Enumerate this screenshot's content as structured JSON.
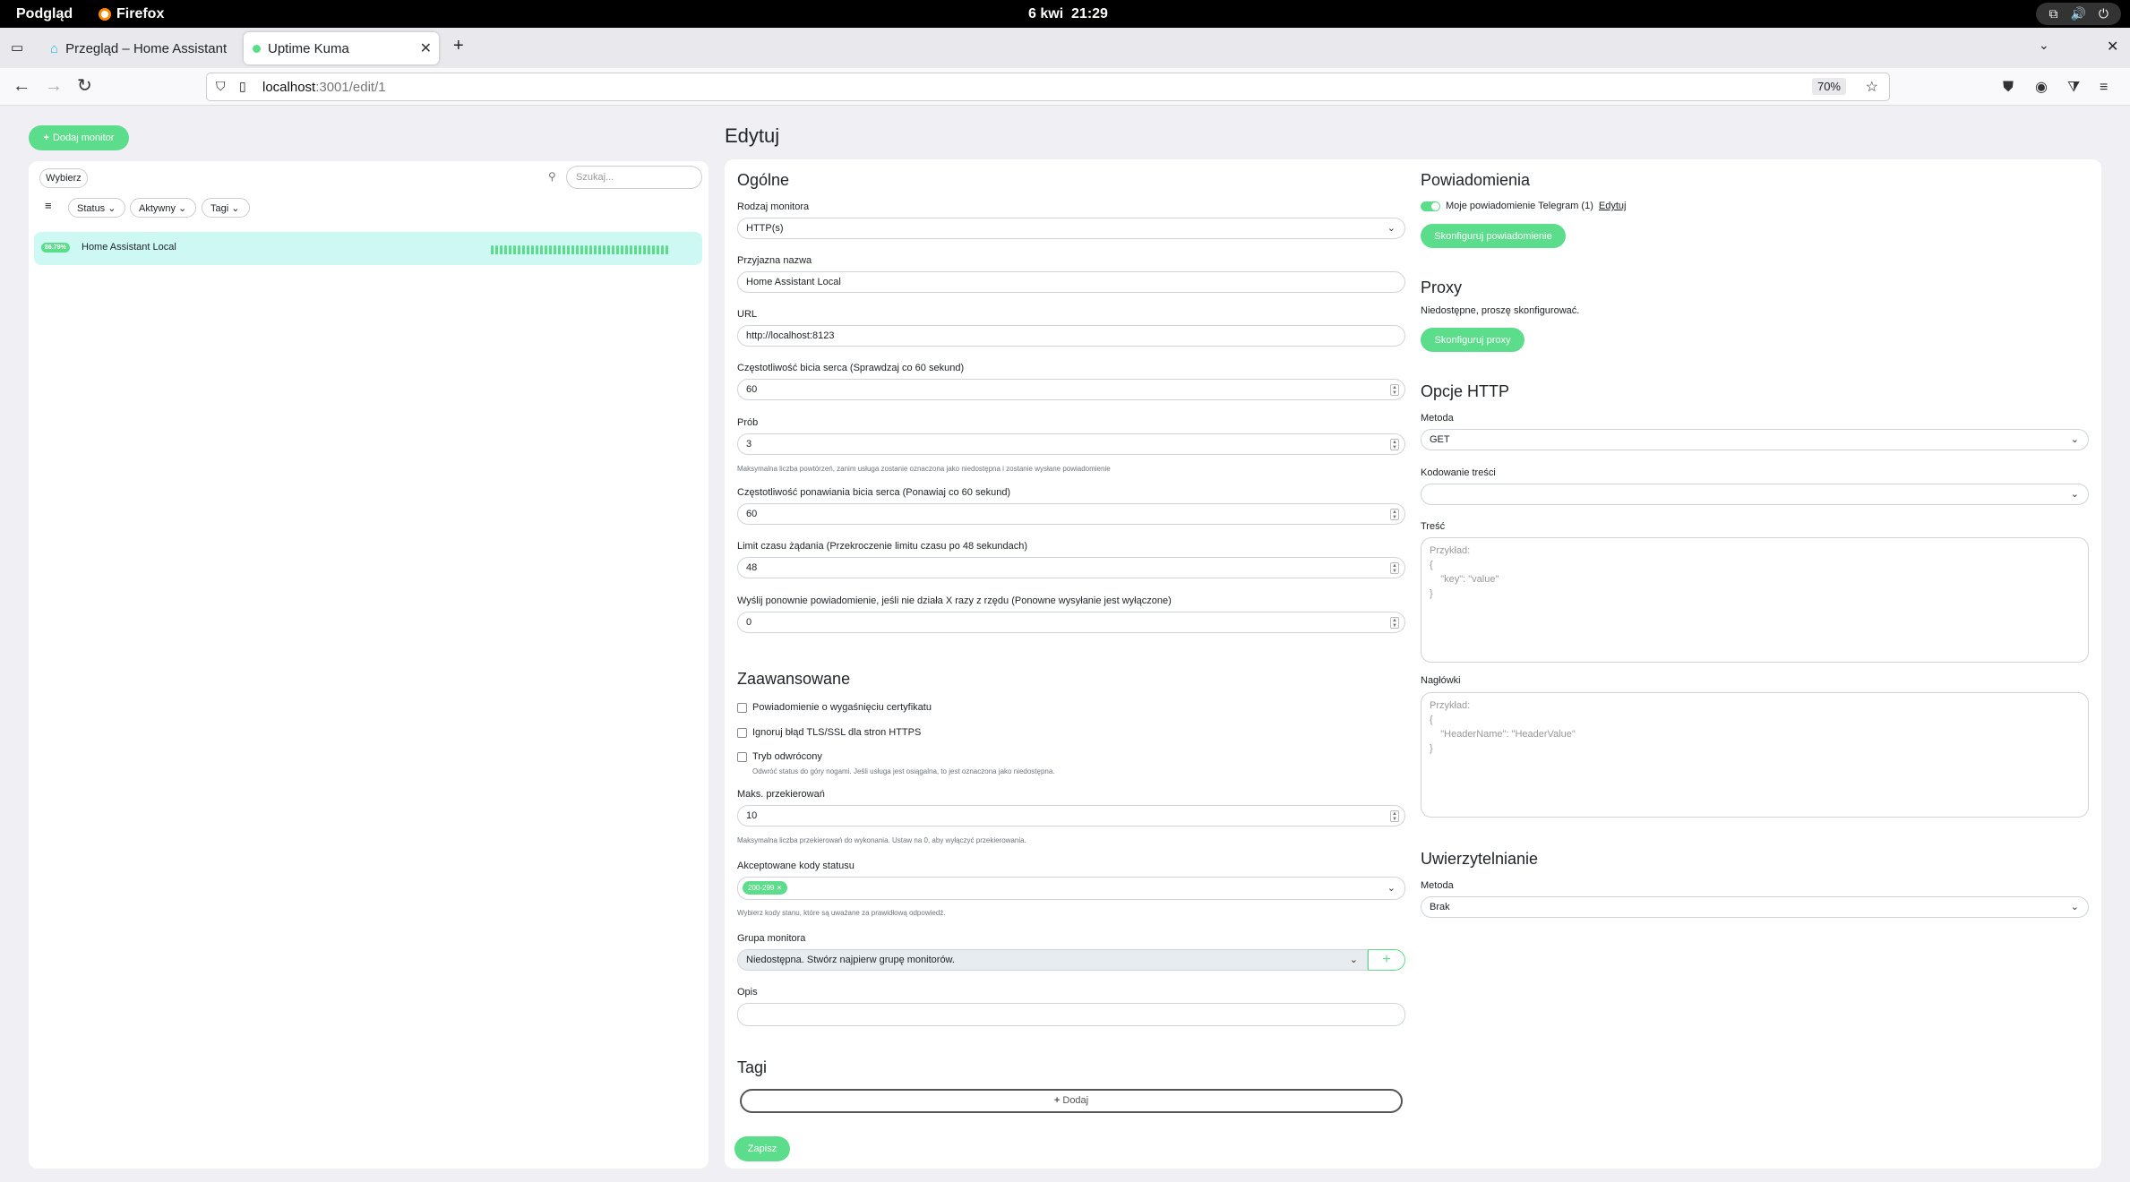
{
  "system": {
    "activities": "Podgląd",
    "app": "Firefox",
    "clock": "6 kwi  21:29"
  },
  "browser": {
    "tabs": [
      {
        "title": "Przegląd – Home Assistant"
      },
      {
        "title": "Uptime Kuma"
      }
    ],
    "url_host": "localhost",
    "url_path": ":3001/edit/1",
    "zoom": "70%"
  },
  "sidebar": {
    "add_button": "Dodaj monitor",
    "select_button": "Wybierz",
    "search_placeholder": "Szukaj...",
    "filters": [
      "Status",
      "Aktywny",
      "Tagi"
    ],
    "monitors": [
      {
        "uptime": "86.79%",
        "name": "Home Assistant Local",
        "beats": 40
      }
    ]
  },
  "page_title": "Edytuj",
  "general": {
    "heading": "Ogólne",
    "monitor_type_label": "Rodzaj monitora",
    "monitor_type_value": "HTTP(s)",
    "friendly_name_label": "Przyjazna nazwa",
    "friendly_name_value": "Home Assistant Local",
    "url_label": "URL",
    "url_value": "http://localhost:8123",
    "interval_label": "Częstotliwość bicia serca (Sprawdzaj co 60 sekund)",
    "interval_value": "60",
    "retries_label": "Prób",
    "retries_value": "3",
    "retries_help": "Maksymalna liczba powtórzeń, zanim usługa zostanie oznaczona jako niedostępna i zostanie wysłane powiadomienie",
    "retry_interval_label": "Częstotliwość ponawiania bicia serca (Ponawiaj co 60 sekund)",
    "retry_interval_value": "60",
    "timeout_label": "Limit czasu żądania (Przekroczenie limitu czasu po 48 sekundach)",
    "timeout_value": "48",
    "resend_label": "Wyślij ponownie powiadomienie, jeśli nie działa X razy z rzędu (Ponowne wysyłanie jest wyłączone)",
    "resend_value": "0"
  },
  "advanced": {
    "heading": "Zaawansowane",
    "cert_expiry": "Powiadomienie o wygaśnięciu certyfikatu",
    "ignore_tls": "Ignoruj błąd TLS/SSL dla stron HTTPS",
    "upside_down": "Tryb odwrócony",
    "upside_down_help": "Odwróć status do góry nogami. Jeśli usługa jest osiągalna, to jest oznaczona jako niedostępna.",
    "max_redirects_label": "Maks. przekierowań",
    "max_redirects_value": "10",
    "max_redirects_help": "Maksymalna liczba przekierowań do wykonania. Ustaw na 0, aby wyłączyć przekierowania.",
    "accepted_codes_label": "Akceptowane kody statusu",
    "accepted_code_tag": "200-299",
    "accepted_codes_help": "Wybierz kody stanu, które są uważane za prawidłową odpowiedź.",
    "group_label": "Grupa monitora",
    "group_value": "Niedostępna. Stwórz najpierw grupę monitorów.",
    "description_label": "Opis",
    "description_value": ""
  },
  "tags": {
    "heading": "Tagi",
    "add_button": "Dodaj"
  },
  "save_button": "Zapisz",
  "notifications": {
    "heading": "Powiadomienia",
    "item": "Moje powiadomienie Telegram (1)",
    "edit_link": "Edytuj",
    "configure_button": "Skonfiguruj powiadomienie"
  },
  "proxy": {
    "heading": "Proxy",
    "text": "Niedostępne, proszę skonfigurować.",
    "configure_button": "Skonfiguruj proxy"
  },
  "http_options": {
    "heading": "Opcje HTTP",
    "method_label": "Metoda",
    "method_value": "GET",
    "encoding_label": "Kodowanie treści",
    "encoding_value": "",
    "body_label": "Treść",
    "body_placeholder": "Przykład:\n{\n    \"key\": \"value\"\n}",
    "headers_label": "Nagłówki",
    "headers_placeholder": "Przykład:\n{\n    \"HeaderName\": \"HeaderValue\"\n}"
  },
  "auth": {
    "heading": "Uwierzytelnianie",
    "method_label": "Metoda",
    "method_value": "Brak"
  },
  "colors": {
    "accent": "#5cdd8b",
    "monitor_active_bg": "#cdf8f4"
  }
}
